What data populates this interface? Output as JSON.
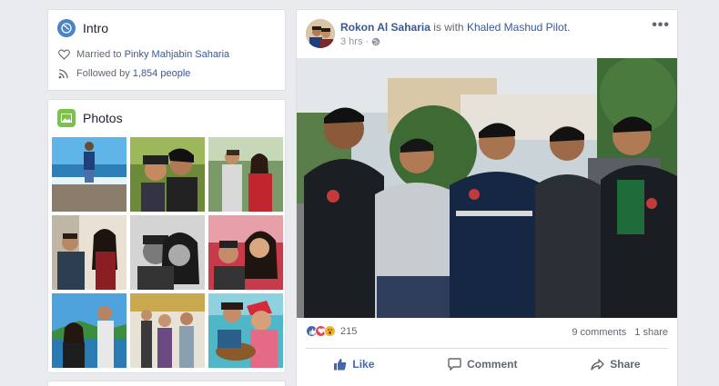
{
  "intro": {
    "title": "Intro",
    "married_prefix": "Married to",
    "married_name": "Pinky Mahjabin Saharia",
    "followed_prefix": "Followed by",
    "followed_count": "1,854 people"
  },
  "photos": {
    "title": "Photos"
  },
  "post": {
    "author": "Rokon Al Saharia",
    "with_text": "is with",
    "tagged": "Khaled Mashud Pilot.",
    "time": "3 hrs",
    "menu": "•••",
    "reaction_count": "215",
    "comments": "9 comments",
    "shares": "1 share",
    "actions": {
      "like": "Like",
      "comment": "Comment",
      "share": "Share"
    }
  },
  "colors": {
    "link": "#385898",
    "like_active": "#4267b2",
    "love": "#f33e58",
    "wow": "#f7b125",
    "intro_icon": "#4c83c3",
    "photos_icon": "#7bc14a"
  }
}
